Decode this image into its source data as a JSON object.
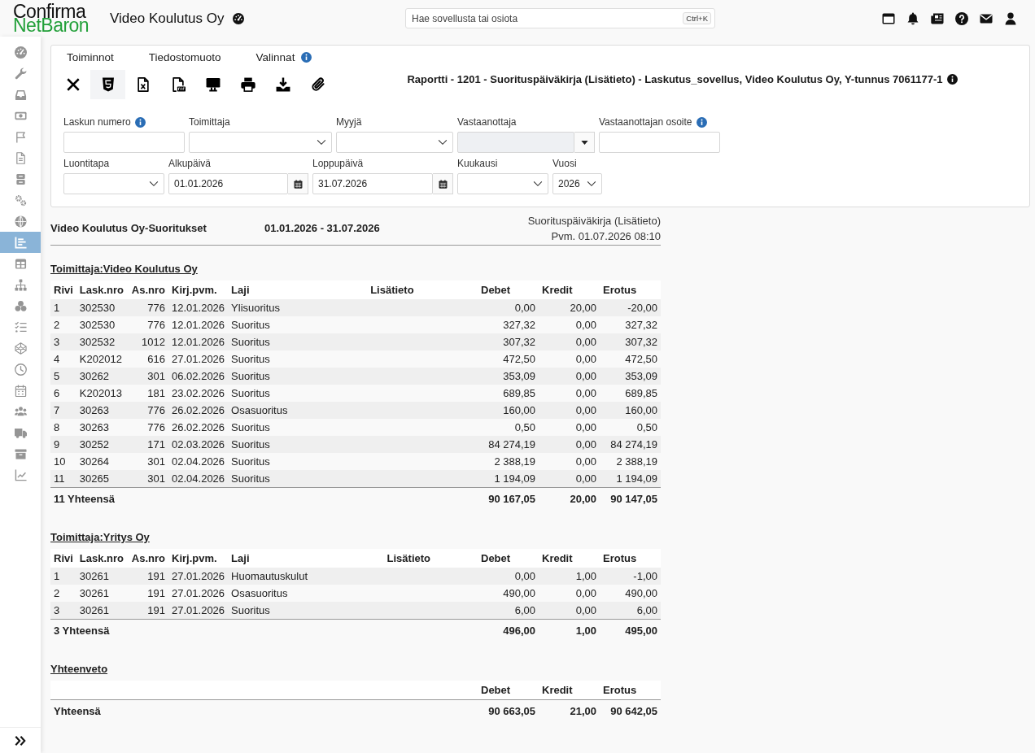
{
  "header": {
    "logo": {
      "line_1": "Confirma",
      "line_2": "NetBaron"
    },
    "title": "Video Koulutus Oy",
    "search": {
      "placeholder": "Hae sovellusta tai osiota",
      "shortcut": "Ctrl+K"
    }
  },
  "sidebar": {
    "items": [
      {
        "selected": false
      },
      {
        "selected": false
      },
      {
        "selected": false
      },
      {
        "selected": false
      },
      {
        "selected": false
      },
      {
        "selected": false
      },
      {
        "selected": false
      },
      {
        "selected": false
      },
      {
        "selected": false
      },
      {
        "selected": true
      },
      {
        "selected": false
      },
      {
        "selected": false
      },
      {
        "selected": false
      },
      {
        "selected": false
      },
      {
        "selected": false
      },
      {
        "selected": false
      },
      {
        "selected": false
      },
      {
        "selected": false
      },
      {
        "selected": false
      },
      {
        "selected": false
      },
      {
        "selected": false
      }
    ]
  },
  "toolbar": {
    "menus": [
      {
        "label": "Toiminnot",
        "info": false
      },
      {
        "label": "Tiedostomuoto",
        "info": false
      },
      {
        "label": "Valinnat",
        "info": true
      }
    ],
    "buttons": [
      {
        "selected": false
      },
      {
        "selected": true
      },
      {
        "selected": false
      },
      {
        "selected": false
      },
      {
        "selected": false
      },
      {
        "selected": false
      },
      {
        "selected": false
      },
      {
        "selected": false
      }
    ]
  },
  "report_title": "Raportti - 1201 - Suorituspäiväkirja (Lisätieto) - Laskutus_sovellus, Video Koulutus Oy, Y-tunnus 7061177-1",
  "filters": [
    [
      {
        "label": "Laskun numero",
        "kind": "text",
        "info": true,
        "disabled": false
      },
      {
        "label": "Toimittaja",
        "kind": "select",
        "info": false,
        "disabled": false
      },
      {
        "label": "Myyjä",
        "kind": "select",
        "info": false,
        "disabled": false
      },
      {
        "label": "Vastaanottaja",
        "kind": "combo",
        "info": false,
        "disabled": true
      },
      {
        "label": "Vastaanottajan osoite",
        "kind": "text",
        "info": true,
        "disabled": false
      }
    ],
    [
      {
        "label": "Luontitapa",
        "kind": "select",
        "info": false,
        "disabled": false
      },
      {
        "label": "Alkupäivä",
        "kind": "date",
        "value": "01.01.2026",
        "info": false,
        "disabled": false
      },
      {
        "label": "Loppupäivä",
        "kind": "date",
        "value": "31.07.2026",
        "info": false,
        "disabled": false
      },
      {
        "label": "Kuukausi",
        "kind": "select",
        "info": false,
        "disabled": false
      },
      {
        "label": "Vuosi",
        "kind": "select",
        "value": "2026",
        "info": false,
        "disabled": false
      }
    ]
  ],
  "report": {
    "heading": "Video Koulutus Oy-Suoritukset",
    "period": "01.01.2026 - 31.07.2026",
    "report_name": "Suorituspäiväkirja (Lisätieto)",
    "printed_at": "Pvm. 01.07.2026 08:10",
    "groups": [
      {
        "title": "Toimittaja:Video Koulutus Oy",
        "columns": [
          "Rivi",
          "Lask.nro",
          "As.nro",
          "Kirj.pvm.",
          "Laji",
          "Lisätieto",
          "Debet",
          "Kredit",
          "Erotus"
        ],
        "rows": [
          {
            "rivi": "1",
            "lask_nro": "302530",
            "as_nro": "776",
            "kirj_pvm": "12.01.2026",
            "laji": "Ylisuoritus",
            "debet": "0,00",
            "kredit": "20,00",
            "erotus": "-20,00"
          },
          {
            "rivi": "2",
            "lask_nro": "302530",
            "as_nro": "776",
            "kirj_pvm": "12.01.2026",
            "laji": "Suoritus",
            "debet": "327,32",
            "kredit": "0,00",
            "erotus": "327,32"
          },
          {
            "rivi": "3",
            "lask_nro": "302532",
            "as_nro": "1012",
            "kirj_pvm": "12.01.2026",
            "laji": "Suoritus",
            "debet": "307,32",
            "kredit": "0,00",
            "erotus": "307,32"
          },
          {
            "rivi": "4",
            "lask_nro": "K202012",
            "as_nro": "616",
            "kirj_pvm": "27.01.2026",
            "laji": "Suoritus",
            "debet": "472,50",
            "kredit": "0,00",
            "erotus": "472,50"
          },
          {
            "rivi": "5",
            "lask_nro": "30262",
            "as_nro": "301",
            "kirj_pvm": "06.02.2026",
            "laji": "Suoritus",
            "debet": "353,09",
            "kredit": "0,00",
            "erotus": "353,09"
          },
          {
            "rivi": "6",
            "lask_nro": "K202013",
            "as_nro": "181",
            "kirj_pvm": "23.02.2026",
            "laji": "Suoritus",
            "debet": "689,85",
            "kredit": "0,00",
            "erotus": "689,85"
          },
          {
            "rivi": "7",
            "lask_nro": "30263",
            "as_nro": "776",
            "kirj_pvm": "26.02.2026",
            "laji": "Osasuoritus",
            "debet": "160,00",
            "kredit": "0,00",
            "erotus": "160,00"
          },
          {
            "rivi": "8",
            "lask_nro": "30263",
            "as_nro": "776",
            "kirj_pvm": "26.02.2026",
            "laji": "Suoritus",
            "debet": "0,50",
            "kredit": "0,00",
            "erotus": "0,50"
          },
          {
            "rivi": "9",
            "lask_nro": "30252",
            "as_nro": "171",
            "kirj_pvm": "02.03.2026",
            "laji": "Suoritus",
            "debet": "84 274,19",
            "kredit": "0,00",
            "erotus": "84 274,19"
          },
          {
            "rivi": "10",
            "lask_nro": "30264",
            "as_nro": "301",
            "kirj_pvm": "02.04.2026",
            "laji": "Suoritus",
            "debet": "2 388,19",
            "kredit": "0,00",
            "erotus": "2 388,19"
          },
          {
            "rivi": "11",
            "lask_nro": "30265",
            "as_nro": "301",
            "kirj_pvm": "02.04.2026",
            "laji": "Suoritus",
            "debet": "1 194,09",
            "kredit": "0,00",
            "erotus": "1 194,09"
          }
        ],
        "total": {
          "label": "11 Yhteensä",
          "debet": "90 167,05",
          "kredit": "20,00",
          "erotus": "90 147,05"
        }
      },
      {
        "title": "Toimittaja:Yritys Oy",
        "columns": [
          "Rivi",
          "Lask.nro",
          "As.nro",
          "Kirj.pvm.",
          "Laji",
          "Lisätieto",
          "Debet",
          "Kredit",
          "Erotus"
        ],
        "rows": [
          {
            "rivi": "1",
            "lask_nro": "30261",
            "as_nro": "191",
            "kirj_pvm": "27.01.2026",
            "laji": "Huomautuskulut",
            "debet": "0,00",
            "kredit": "1,00",
            "erotus": "-1,00"
          },
          {
            "rivi": "2",
            "lask_nro": "30261",
            "as_nro": "191",
            "kirj_pvm": "27.01.2026",
            "laji": "Osasuoritus",
            "debet": "490,00",
            "kredit": "0,00",
            "erotus": "490,00"
          },
          {
            "rivi": "3",
            "lask_nro": "30261",
            "as_nro": "191",
            "kirj_pvm": "27.01.2026",
            "laji": "Suoritus",
            "debet": "6,00",
            "kredit": "0,00",
            "erotus": "6,00"
          }
        ],
        "total": {
          "label": "3 Yhteensä",
          "debet": "496,00",
          "kredit": "1,00",
          "erotus": "495,00"
        }
      }
    ],
    "summary": {
      "title": "Yhteenveto",
      "columns": [
        "Debet",
        "Kredit",
        "Erotus"
      ],
      "total": {
        "label": "Yhteensä",
        "debet": "90 663,05",
        "kredit": "21,00",
        "erotus": "90 642,05"
      }
    }
  }
}
